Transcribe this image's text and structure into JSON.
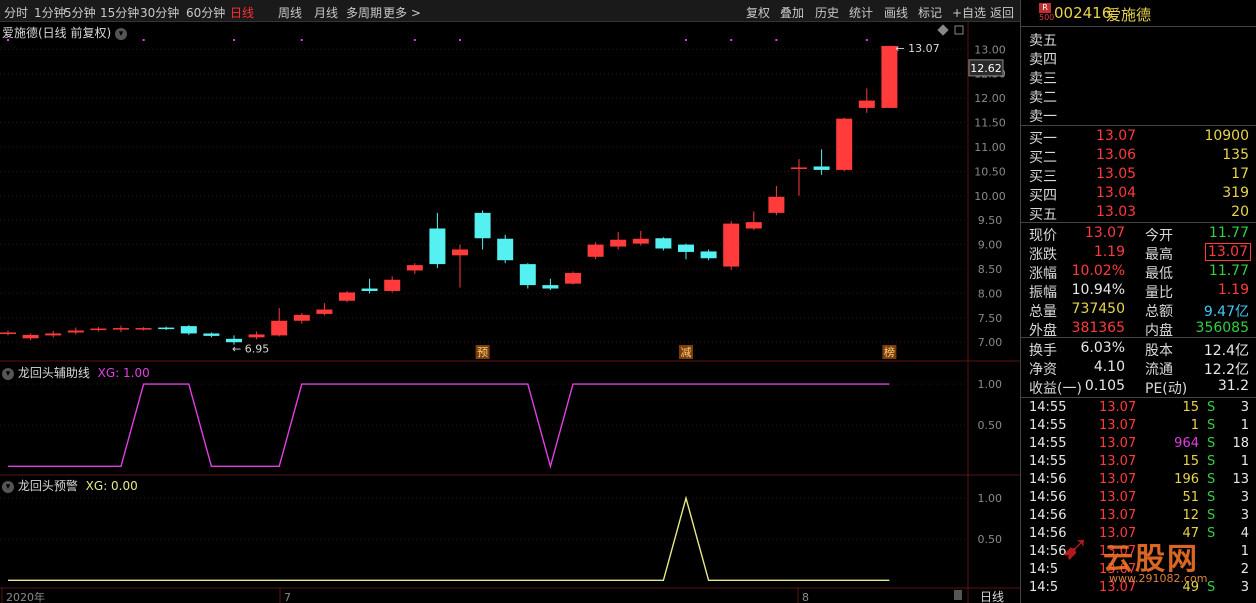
{
  "toolbar": {
    "left": [
      "分时",
      "1分钟",
      "5分钟",
      "15分钟",
      "30分钟",
      "60分钟",
      "日线",
      "周线",
      "月线",
      "多周期",
      "更多 >"
    ],
    "active": "日线",
    "right": [
      "复权",
      "叠加",
      "历史",
      "统计",
      "画线",
      "标记",
      "+自选",
      "返回"
    ]
  },
  "main_title": "爱施德(日线 前复权)",
  "ind1_title": "龙回头辅助线",
  "ind1_value": "XG: 1.00",
  "ind2_title": "龙回头预警",
  "ind2_value": "XG: 0.00",
  "last_price_label": "12.62",
  "high_label": "13.07",
  "low_label": "6.95",
  "markers": [
    "预",
    "减",
    "榜"
  ],
  "x_labels": [
    "2020年",
    "7",
    "8"
  ],
  "period_label": "日线",
  "chart_data": [
    {
      "type": "candlestick",
      "title": "爱施德(日线 前复权)",
      "y_ticks": [
        7.0,
        7.5,
        8.0,
        8.5,
        9.0,
        9.5,
        10.0,
        10.5,
        11.0,
        11.5,
        12.0,
        12.5,
        13.0
      ],
      "ylim": [
        6.8,
        13.15
      ],
      "candles": [
        {
          "o": 7.18,
          "c": 7.2,
          "h": 7.24,
          "l": 7.14
        },
        {
          "o": 7.08,
          "c": 7.15,
          "h": 7.18,
          "l": 7.04
        },
        {
          "o": 7.14,
          "c": 7.18,
          "h": 7.23,
          "l": 7.1
        },
        {
          "o": 7.2,
          "c": 7.24,
          "h": 7.3,
          "l": 7.16
        },
        {
          "o": 7.25,
          "c": 7.28,
          "h": 7.31,
          "l": 7.22
        },
        {
          "o": 7.26,
          "c": 7.29,
          "h": 7.34,
          "l": 7.21
        },
        {
          "o": 7.27,
          "c": 7.29,
          "h": 7.31,
          "l": 7.24
        },
        {
          "o": 7.3,
          "c": 7.28,
          "h": 7.32,
          "l": 7.25
        },
        {
          "o": 7.33,
          "c": 7.18,
          "h": 7.35,
          "l": 7.15
        },
        {
          "o": 7.18,
          "c": 7.13,
          "h": 7.2,
          "l": 7.1
        },
        {
          "o": 7.07,
          "c": 7.0,
          "h": 7.14,
          "l": 6.95
        },
        {
          "o": 7.1,
          "c": 7.16,
          "h": 7.22,
          "l": 7.06
        },
        {
          "o": 7.14,
          "c": 7.44,
          "h": 7.7,
          "l": 7.12
        },
        {
          "o": 7.44,
          "c": 7.56,
          "h": 7.6,
          "l": 7.38
        },
        {
          "o": 7.58,
          "c": 7.67,
          "h": 7.8,
          "l": 7.55
        },
        {
          "o": 7.85,
          "c": 8.02,
          "h": 8.05,
          "l": 7.82
        },
        {
          "o": 8.1,
          "c": 8.05,
          "h": 8.3,
          "l": 8.0
        },
        {
          "o": 8.05,
          "c": 8.28,
          "h": 8.35,
          "l": 8.02
        },
        {
          "o": 8.47,
          "c": 8.58,
          "h": 8.62,
          "l": 8.4
        },
        {
          "o": 9.33,
          "c": 8.6,
          "h": 9.65,
          "l": 8.52
        },
        {
          "o": 8.78,
          "c": 8.9,
          "h": 9.0,
          "l": 8.12
        },
        {
          "o": 9.65,
          "c": 9.13,
          "h": 9.7,
          "l": 8.9
        },
        {
          "o": 9.12,
          "c": 8.68,
          "h": 9.2,
          "l": 8.62
        },
        {
          "o": 8.6,
          "c": 8.17,
          "h": 8.62,
          "l": 8.1
        },
        {
          "o": 8.17,
          "c": 8.1,
          "h": 8.3,
          "l": 8.07
        },
        {
          "o": 8.2,
          "c": 8.42,
          "h": 8.45,
          "l": 8.18
        },
        {
          "o": 8.75,
          "c": 9.0,
          "h": 9.05,
          "l": 8.7
        },
        {
          "o": 8.96,
          "c": 9.1,
          "h": 9.26,
          "l": 8.9
        },
        {
          "o": 9.02,
          "c": 9.12,
          "h": 9.28,
          "l": 8.98
        },
        {
          "o": 9.13,
          "c": 8.92,
          "h": 9.15,
          "l": 8.88
        },
        {
          "o": 9.0,
          "c": 8.85,
          "h": 9.02,
          "l": 8.7
        },
        {
          "o": 8.86,
          "c": 8.72,
          "h": 8.9,
          "l": 8.68
        },
        {
          "o": 8.55,
          "c": 9.43,
          "h": 9.48,
          "l": 8.48
        },
        {
          "o": 9.33,
          "c": 9.46,
          "h": 9.68,
          "l": 9.3
        },
        {
          "o": 9.65,
          "c": 9.98,
          "h": 10.2,
          "l": 9.6
        },
        {
          "o": 10.55,
          "c": 10.58,
          "h": 10.75,
          "l": 10.0
        },
        {
          "o": 10.6,
          "c": 10.53,
          "h": 10.95,
          "l": 10.43
        },
        {
          "o": 10.53,
          "c": 11.58,
          "h": 11.6,
          "l": 10.5
        },
        {
          "o": 11.8,
          "c": 11.95,
          "h": 12.2,
          "l": 11.7
        },
        {
          "o": 11.8,
          "c": 13.07,
          "h": 13.07,
          "l": 11.8
        }
      ]
    },
    {
      "type": "line",
      "title": "龙回头辅助线",
      "y_ticks": [
        0.5,
        1.0
      ],
      "ylim": [
        -0.02,
        1.05
      ],
      "values": [
        0,
        0,
        0,
        0,
        0,
        0,
        1,
        1,
        1,
        0,
        0,
        0,
        0,
        1,
        1,
        1,
        1,
        1,
        1,
        1,
        1,
        1,
        1,
        1,
        0,
        1,
        1,
        1,
        1,
        1,
        1,
        1,
        1,
        1,
        1,
        1,
        1,
        1,
        1,
        1
      ]
    },
    {
      "type": "line",
      "title": "龙回头预警",
      "y_ticks": [
        0.5,
        1.0
      ],
      "ylim": [
        -0.02,
        1.05
      ],
      "values": [
        0,
        0,
        0,
        0,
        0,
        0,
        0,
        0,
        0,
        0,
        0,
        0,
        0,
        0,
        0,
        0,
        0,
        0,
        0,
        0,
        0,
        0,
        0,
        0,
        0,
        0,
        0,
        0,
        0,
        0,
        1,
        0,
        0,
        0,
        0,
        0,
        0,
        0,
        0,
        0
      ]
    }
  ],
  "stock": {
    "code_prefix": "R",
    "code_sub": "500",
    "code": "002416",
    "name": "爱施德"
  },
  "sell": [
    {
      "label": "卖五",
      "price": "",
      "vol": ""
    },
    {
      "label": "卖四",
      "price": "",
      "vol": ""
    },
    {
      "label": "卖三",
      "price": "",
      "vol": ""
    },
    {
      "label": "卖二",
      "price": "",
      "vol": ""
    },
    {
      "label": "卖一",
      "price": "",
      "vol": ""
    }
  ],
  "buy": [
    {
      "label": "买一",
      "price": "13.07",
      "vol": "10900"
    },
    {
      "label": "买二",
      "price": "13.06",
      "vol": "135"
    },
    {
      "label": "买三",
      "price": "13.05",
      "vol": "17"
    },
    {
      "label": "买四",
      "price": "13.04",
      "vol": "319"
    },
    {
      "label": "买五",
      "price": "13.03",
      "vol": "20"
    }
  ],
  "quote": [
    {
      "l1": "现价",
      "v1": "13.07",
      "c1": "red",
      "l2": "今开",
      "v2": "11.77",
      "c2": "green"
    },
    {
      "l1": "涨跌",
      "v1": "1.19",
      "c1": "red",
      "l2": "最高",
      "v2": "13.07",
      "c2": "redbox"
    },
    {
      "l1": "涨幅",
      "v1": "10.02%",
      "c1": "red",
      "l2": "最低",
      "v2": "11.77",
      "c2": "green"
    },
    {
      "l1": "振幅",
      "v1": "10.94%",
      "c1": "white",
      "l2": "量比",
      "v2": "1.19",
      "c2": "red"
    },
    {
      "l1": "总量",
      "v1": "737450",
      "c1": "yellow",
      "l2": "总额",
      "v2": "9.47亿",
      "c2": "cyan"
    },
    {
      "l1": "外盘",
      "v1": "381365",
      "c1": "red",
      "l2": "内盘",
      "v2": "356085",
      "c2": "green"
    }
  ],
  "fin": [
    {
      "l1": "换手",
      "v1": "6.03%",
      "l2": "股本",
      "v2": "12.4亿"
    },
    {
      "l1": "净资",
      "v1": "4.10",
      "l2": "流通",
      "v2": "12.2亿"
    },
    {
      "l1": "收益(一)",
      "v1": "0.105",
      "l2": "PE(动)",
      "v2": "31.2"
    }
  ],
  "ticks": [
    {
      "t": "14:55",
      "p": "13.07",
      "v": "15",
      "vc": "yellow",
      "bs": "S",
      "n": "3"
    },
    {
      "t": "14:55",
      "p": "13.07",
      "v": "1",
      "vc": "yellow",
      "bs": "S",
      "n": "1"
    },
    {
      "t": "14:55",
      "p": "13.07",
      "v": "964",
      "vc": "purple",
      "bs": "S",
      "n": "18"
    },
    {
      "t": "14:55",
      "p": "13.07",
      "v": "15",
      "vc": "yellow",
      "bs": "S",
      "n": "1"
    },
    {
      "t": "14:56",
      "p": "13.07",
      "v": "196",
      "vc": "yellow",
      "bs": "S",
      "n": "13"
    },
    {
      "t": "14:56",
      "p": "13.07",
      "v": "51",
      "vc": "yellow",
      "bs": "S",
      "n": "3"
    },
    {
      "t": "14:56",
      "p": "13.07",
      "v": "12",
      "vc": "yellow",
      "bs": "S",
      "n": "3"
    },
    {
      "t": "14:56",
      "p": "13.07",
      "v": "47",
      "vc": "yellow",
      "bs": "S",
      "n": "4"
    },
    {
      "t": "14:56",
      "p": "13.07",
      "v": "",
      "vc": "yellow",
      "bs": "",
      "n": "1"
    },
    {
      "t": "14:5",
      "p": "13.07",
      "v": "",
      "vc": "yellow",
      "bs": "",
      "n": "2"
    },
    {
      "t": "14:5",
      "p": "13.07",
      "v": "49",
      "vc": "yellow",
      "bs": "S",
      "n": "3"
    }
  ],
  "watermark": {
    "text": "云股网",
    "url": "www.291082.com"
  },
  "colors": {
    "up": "#ff3b3b",
    "down": "#55f0f0",
    "grid": "#3a0f0f",
    "ind1": "#e040e0",
    "ind2": "#e8e88a"
  }
}
